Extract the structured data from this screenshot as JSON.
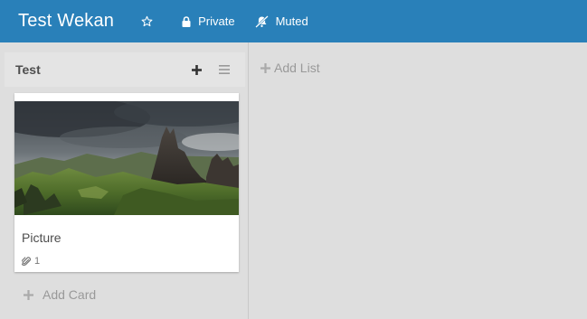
{
  "header": {
    "board_title": "Test Wekan",
    "private_label": "Private",
    "muted_label": "Muted"
  },
  "list": {
    "title": "Test",
    "add_card_label": "Add Card"
  },
  "card": {
    "title": "Picture",
    "attachment_count": "1"
  },
  "add_list_label": "Add List",
  "colors": {
    "header_bg": "#2980b9",
    "board_bg": "#dedede",
    "list_header_bg": "#e4e4e4",
    "card_bg": "#ffffff",
    "muted_text": "#999999"
  }
}
